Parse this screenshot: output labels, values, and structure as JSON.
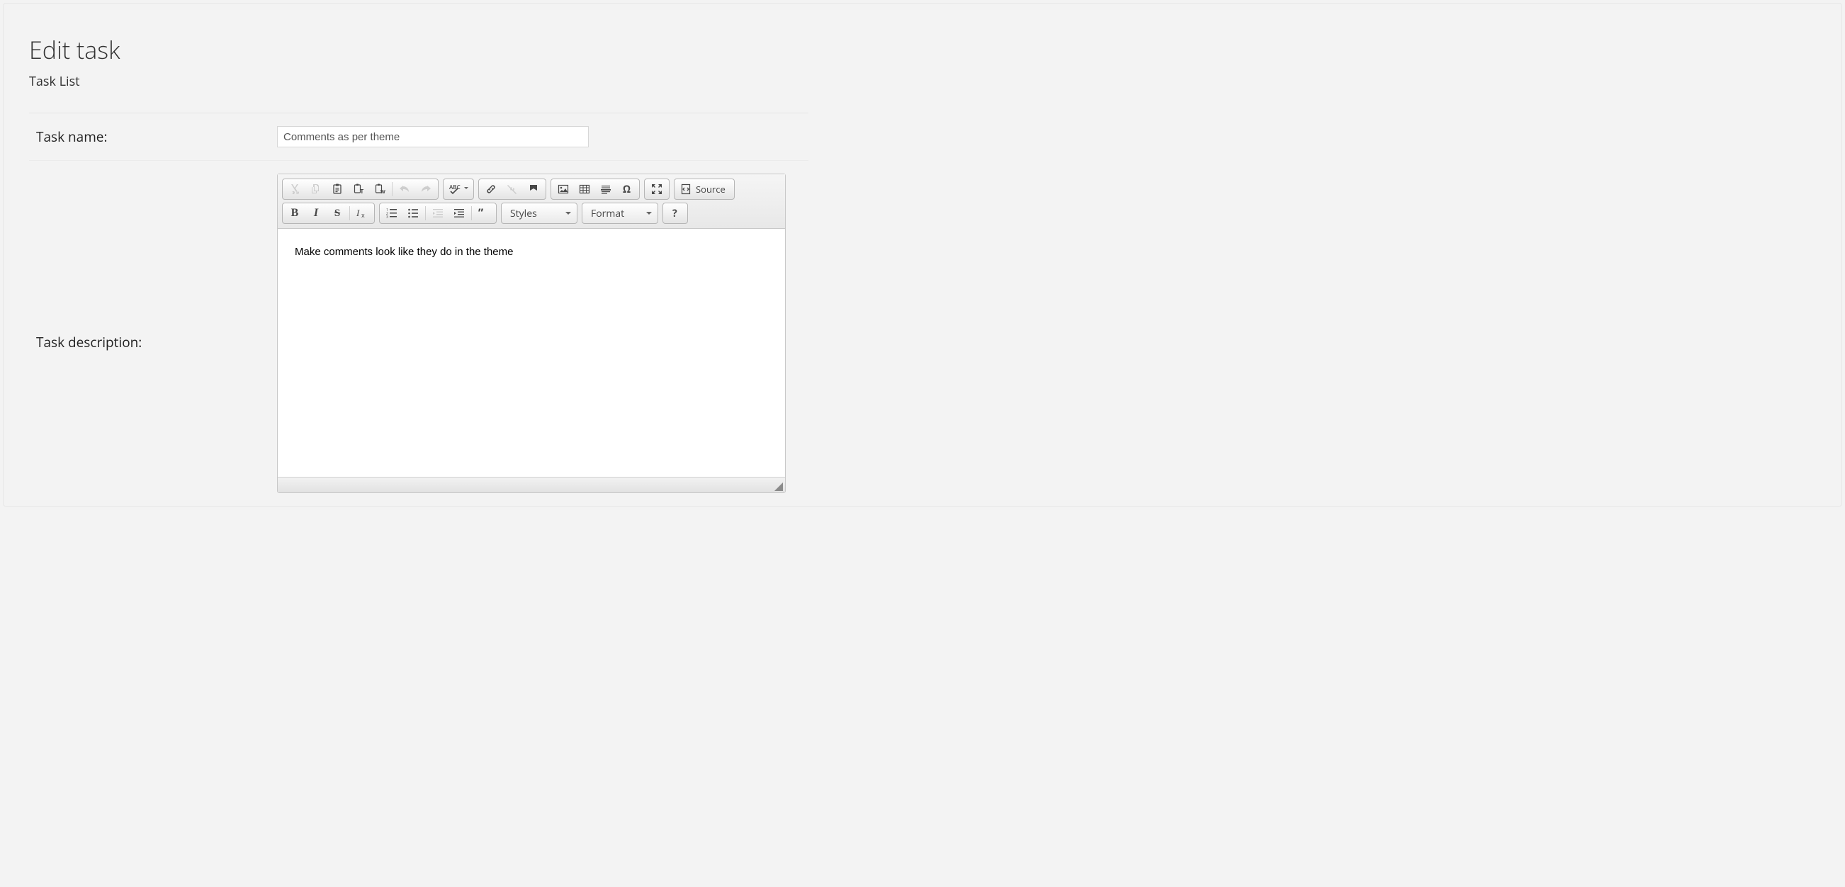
{
  "header": {
    "title": "Edit task",
    "subtitle": "Task List"
  },
  "form": {
    "task_name_label": "Task name:",
    "task_name_value": "Comments as per theme",
    "task_description_label": "Task description:",
    "task_description_value": "Make comments look like they do in the theme"
  },
  "editor": {
    "source_label": "Source",
    "styles_label": "Styles",
    "format_label": "Format",
    "spell_abc": "ABC"
  }
}
